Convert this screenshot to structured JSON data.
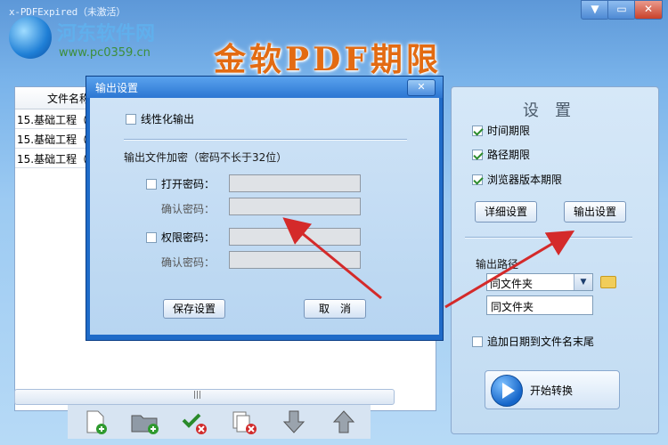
{
  "window": {
    "title": "x-PDFExpired（未激活）",
    "banner": "金软PDF期限",
    "min_glyph": "▼",
    "restore_glyph": "▭",
    "close_glyph": "✕"
  },
  "watermark": {
    "name": "河东软件网",
    "url": "www.pc0359.cn"
  },
  "file_list": {
    "header": "文件名称",
    "rows": [
      "15.基础工程（",
      "15.基础工程（",
      "15.基础工程（"
    ],
    "scroll_grip": "|||"
  },
  "toolbar": {
    "icons": [
      "add-file-icon",
      "add-folder-icon",
      "remove-checked-icon",
      "remove-all-icon",
      "move-down-icon",
      "move-up-icon"
    ]
  },
  "settings": {
    "title": "设置",
    "options": [
      {
        "label": "时间期限",
        "checked": true
      },
      {
        "label": "路径期限",
        "checked": true
      },
      {
        "label": "浏览器版本期限",
        "checked": true
      }
    ],
    "detail_button": "详细设置",
    "output_button": "输出设置",
    "output_path_label": "输出路径",
    "output_path_select": "同文件夹",
    "output_path_value": "同文件夹",
    "append_date_label": "追加日期到文件名末尾",
    "append_date_checked": false,
    "start_button": "开始转换"
  },
  "dialog": {
    "title": "输出设置",
    "close_glyph": "✕",
    "linearize_label": "线性化输出",
    "linearize_checked": false,
    "encrypt_label": "输出文件加密（密码不长于32位）",
    "open_password_label": "打开密码：",
    "open_password_checked": false,
    "confirm_password_label": "确认密码：",
    "perm_password_label": "权限密码：",
    "perm_password_checked": false,
    "confirm_password_label2": "确认密码：",
    "save_button": "保存设置",
    "cancel_button": "取　消"
  },
  "colors": {
    "accent": "#1f6bc8",
    "banner": "#e36b12",
    "arrow": "#d42a2a"
  }
}
